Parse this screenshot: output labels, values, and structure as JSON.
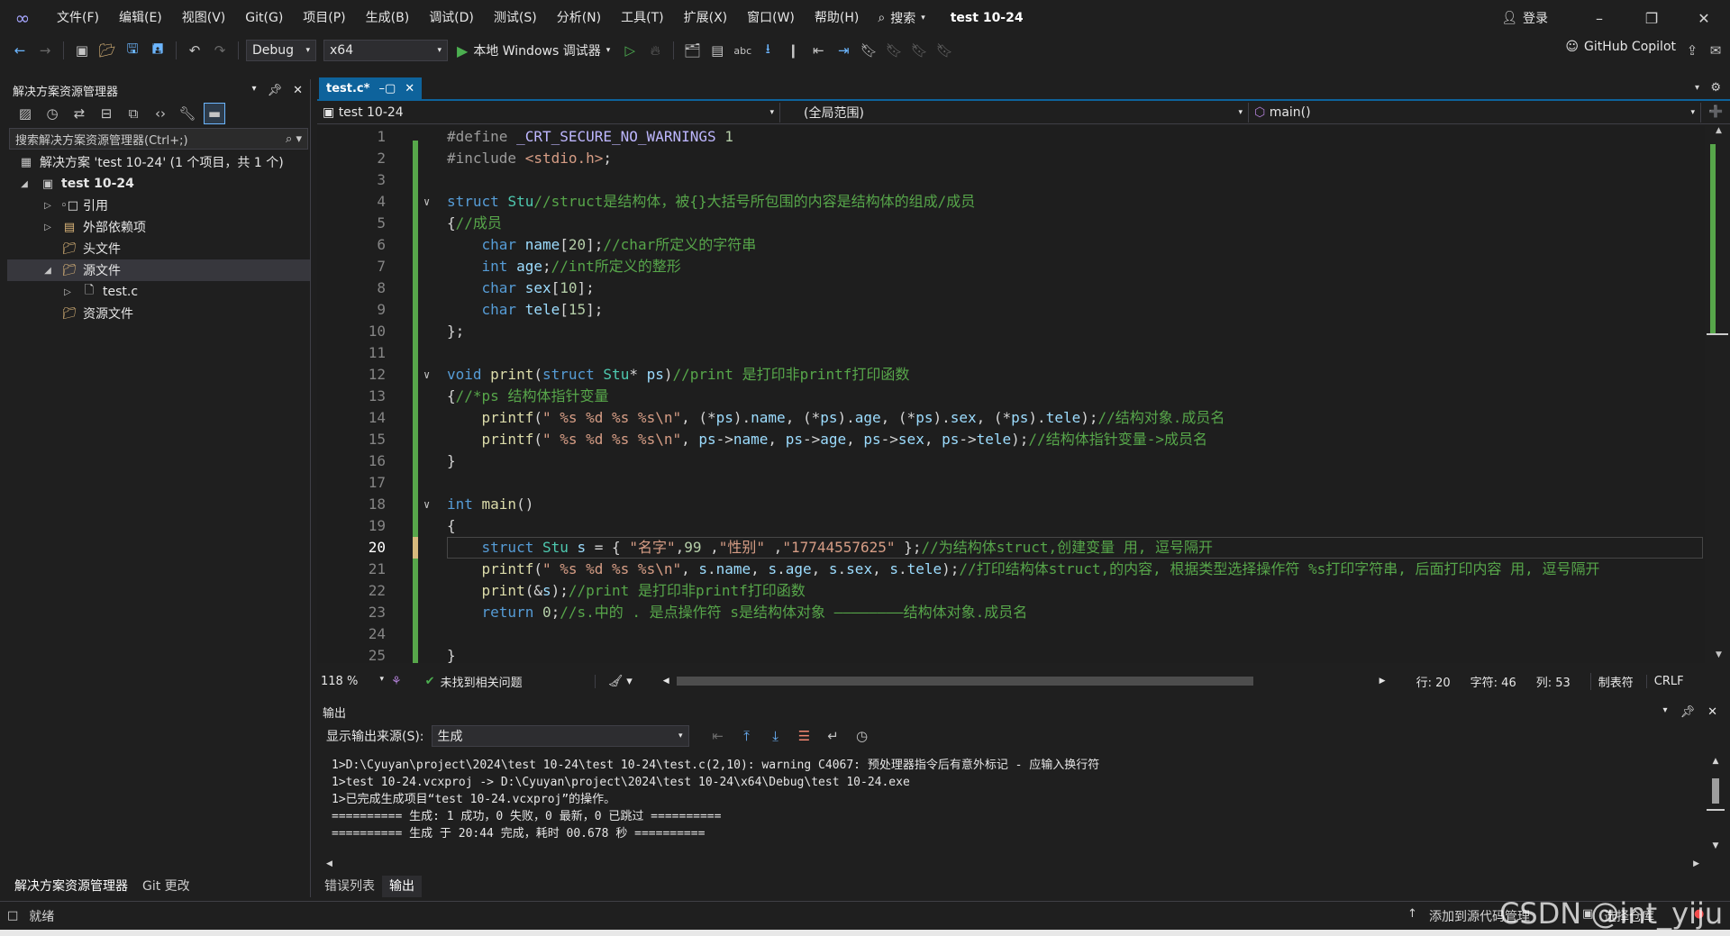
{
  "menu": {
    "items": [
      "文件(F)",
      "编辑(E)",
      "视图(V)",
      "Git(G)",
      "项目(P)",
      "生成(B)",
      "调试(D)",
      "测试(S)",
      "分析(N)",
      "工具(T)",
      "扩展(X)",
      "窗口(W)",
      "帮助(H)"
    ],
    "search_label": "搜索",
    "project_title": "test 10-24",
    "login_label": "登录"
  },
  "toolbar": {
    "config": "Debug",
    "platform": "x64",
    "run_label": "本地 Windows 调试器",
    "copilot_label": "GitHub Copilot"
  },
  "solution_explorer": {
    "title": "解决方案资源管理器",
    "search_placeholder": "搜索解决方案资源管理器(Ctrl+;)",
    "tree": [
      {
        "label": "解决方案 'test 10-24' (1 个项目，共 1 个)",
        "bold": false
      },
      {
        "label": "test 10-24",
        "bold": true
      },
      {
        "label": "引用"
      },
      {
        "label": "外部依赖项"
      },
      {
        "label": "头文件"
      },
      {
        "label": "源文件"
      },
      {
        "label": "test.c"
      },
      {
        "label": "资源文件"
      }
    ],
    "bottom_tabs": [
      "解决方案资源管理器",
      "Git 更改"
    ]
  },
  "editor": {
    "tab_label": "test.c*",
    "nav_project": "test 10-24",
    "nav_scope": "(全局范围)",
    "nav_function": "main()",
    "lines": [
      [
        [
          "pp",
          "#define "
        ],
        [
          "mc",
          "_CRT_SECURE_NO_WARNINGS"
        ],
        [
          "tx",
          " "
        ],
        [
          "nm",
          "1"
        ]
      ],
      [
        [
          "pp",
          "#include "
        ],
        [
          "st",
          "<stdio.h>"
        ],
        [
          "tx",
          ";"
        ]
      ],
      [],
      [
        [
          "kw",
          "struct "
        ],
        [
          "ty",
          "Stu"
        ],
        [
          "cm",
          "//struct是结构体，被{}大括号所包围的内容是结构体的组成/成员"
        ]
      ],
      [
        [
          "tx",
          "{"
        ],
        [
          "cm",
          "//成员"
        ]
      ],
      [
        [
          "tx",
          "    "
        ],
        [
          "kw",
          "char "
        ],
        [
          "vr",
          "name"
        ],
        [
          "tx",
          "["
        ],
        [
          "nm",
          "20"
        ],
        [
          "tx",
          "];"
        ],
        [
          "cm",
          "//char所定义的字符串"
        ]
      ],
      [
        [
          "tx",
          "    "
        ],
        [
          "kw",
          "int "
        ],
        [
          "vr",
          "age"
        ],
        [
          "tx",
          ";"
        ],
        [
          "cm",
          "//int所定义的整形"
        ]
      ],
      [
        [
          "tx",
          "    "
        ],
        [
          "kw",
          "char "
        ],
        [
          "vr",
          "sex"
        ],
        [
          "tx",
          "["
        ],
        [
          "nm",
          "10"
        ],
        [
          "tx",
          "];"
        ]
      ],
      [
        [
          "tx",
          "    "
        ],
        [
          "kw",
          "char "
        ],
        [
          "vr",
          "tele"
        ],
        [
          "tx",
          "["
        ],
        [
          "nm",
          "15"
        ],
        [
          "tx",
          "];"
        ]
      ],
      [
        [
          "tx",
          "};"
        ]
      ],
      [],
      [
        [
          "kw",
          "void "
        ],
        [
          "fn",
          "print"
        ],
        [
          "tx",
          "("
        ],
        [
          "kw",
          "struct "
        ],
        [
          "ty",
          "Stu"
        ],
        [
          "tx",
          "* "
        ],
        [
          "vr",
          "ps"
        ],
        [
          "tx",
          ")"
        ],
        [
          "cm",
          "//print 是打印非printf打印函数"
        ]
      ],
      [
        [
          "tx",
          "{"
        ],
        [
          "cm",
          "//*ps 结构体指针变量"
        ]
      ],
      [
        [
          "tx",
          "    "
        ],
        [
          "fn",
          "printf"
        ],
        [
          "tx",
          "("
        ],
        [
          "st",
          "\" %s %d %s %s\\n\""
        ],
        [
          "tx",
          ", (*"
        ],
        [
          "vr",
          "ps"
        ],
        [
          "tx",
          ")."
        ],
        [
          "vr",
          "name"
        ],
        [
          "tx",
          ", (*"
        ],
        [
          "vr",
          "ps"
        ],
        [
          "tx",
          ")."
        ],
        [
          "vr",
          "age"
        ],
        [
          "tx",
          ", (*"
        ],
        [
          "vr",
          "ps"
        ],
        [
          "tx",
          ")."
        ],
        [
          "vr",
          "sex"
        ],
        [
          "tx",
          ", (*"
        ],
        [
          "vr",
          "ps"
        ],
        [
          "tx",
          ")."
        ],
        [
          "vr",
          "tele"
        ],
        [
          "tx",
          ");"
        ],
        [
          "cm",
          "//结构对象.成员名"
        ]
      ],
      [
        [
          "tx",
          "    "
        ],
        [
          "fn",
          "printf"
        ],
        [
          "tx",
          "("
        ],
        [
          "st",
          "\" %s %d %s %s\\n\""
        ],
        [
          "tx",
          ", "
        ],
        [
          "vr",
          "ps"
        ],
        [
          "tx",
          "->"
        ],
        [
          "vr",
          "name"
        ],
        [
          "tx",
          ", "
        ],
        [
          "vr",
          "ps"
        ],
        [
          "tx",
          "->"
        ],
        [
          "vr",
          "age"
        ],
        [
          "tx",
          ", "
        ],
        [
          "vr",
          "ps"
        ],
        [
          "tx",
          "->"
        ],
        [
          "vr",
          "sex"
        ],
        [
          "tx",
          ", "
        ],
        [
          "vr",
          "ps"
        ],
        [
          "tx",
          "->"
        ],
        [
          "vr",
          "tele"
        ],
        [
          "tx",
          ");"
        ],
        [
          "cm",
          "//结构体指针变量->成员名"
        ]
      ],
      [
        [
          "tx",
          "}"
        ]
      ],
      [],
      [
        [
          "kw",
          "int "
        ],
        [
          "fn",
          "main"
        ],
        [
          "tx",
          "()"
        ]
      ],
      [
        [
          "tx",
          "{"
        ]
      ],
      [
        [
          "tx",
          "    "
        ],
        [
          "kw",
          "struct "
        ],
        [
          "ty",
          "Stu "
        ],
        [
          "vr",
          "s"
        ],
        [
          "tx",
          " = { "
        ],
        [
          "st",
          "\"名字\""
        ],
        [
          "tx",
          ","
        ],
        [
          "nm",
          "99"
        ],
        [
          "tx",
          " ,"
        ],
        [
          "st",
          "\"性别\""
        ],
        [
          "tx",
          " ,"
        ],
        [
          "st",
          "\"17744557625\""
        ],
        [
          "tx",
          " };"
        ],
        [
          "cm",
          "//为结构体struct,创建变量 用, 逗号隔开"
        ]
      ],
      [
        [
          "tx",
          "    "
        ],
        [
          "fn",
          "printf"
        ],
        [
          "tx",
          "("
        ],
        [
          "st",
          "\" %s %d %s %s\\n\""
        ],
        [
          "tx",
          ", "
        ],
        [
          "vr",
          "s"
        ],
        [
          "tx",
          "."
        ],
        [
          "vr",
          "name"
        ],
        [
          "tx",
          ", "
        ],
        [
          "vr",
          "s"
        ],
        [
          "tx",
          "."
        ],
        [
          "vr",
          "age"
        ],
        [
          "tx",
          ", "
        ],
        [
          "vr",
          "s"
        ],
        [
          "tx",
          "."
        ],
        [
          "vr",
          "sex"
        ],
        [
          "tx",
          ", "
        ],
        [
          "vr",
          "s"
        ],
        [
          "tx",
          "."
        ],
        [
          "vr",
          "tele"
        ],
        [
          "tx",
          ");"
        ],
        [
          "cm",
          "//打印结构体struct,的内容, 根据类型选择操作符 %s打印字符串, 后面打印内容 用, 逗号隔开"
        ]
      ],
      [
        [
          "tx",
          "    "
        ],
        [
          "fn",
          "print"
        ],
        [
          "tx",
          "(&"
        ],
        [
          "vr",
          "s"
        ],
        [
          "tx",
          ");"
        ],
        [
          "cm",
          "//print 是打印非printf打印函数"
        ]
      ],
      [
        [
          "tx",
          "    "
        ],
        [
          "kw",
          "return "
        ],
        [
          "nm",
          "0"
        ],
        [
          "tx",
          ";"
        ],
        [
          "cm",
          "//s.中的 . 是点操作符 s是结构体对象 ————————结构体对象.成员名"
        ]
      ],
      [],
      [
        [
          "tx",
          "}"
        ]
      ]
    ],
    "current_line": 20,
    "status": {
      "zoom": "118 %",
      "issues": "未找到相关问题",
      "row": "行: 20",
      "char": "字符: 46",
      "col": "列: 53",
      "tab_mode": "制表符",
      "eol": "CRLF"
    }
  },
  "output": {
    "title": "输出",
    "source_label": "显示输出来源(S):",
    "source_value": "生成",
    "lines": [
      "1>D:\\Cyuyan\\project\\2024\\test 10-24\\test 10-24\\test.c(2,10): warning C4067: 预处理器指令后有意外标记 - 应输入换行符",
      "1>test 10-24.vcxproj -> D:\\Cyuyan\\project\\2024\\test 10-24\\x64\\Debug\\test 10-24.exe",
      "1>已完成生成项目“test 10-24.vcxproj”的操作。",
      "========== 生成: 1 成功，0 失败，0 最新，0 已跳过 ==========",
      "========== 生成 于 20:44 完成，耗时 00.678 秒 =========="
    ],
    "bottom_tabs": [
      "错误列表",
      "输出"
    ]
  },
  "statusbar": {
    "ready": "就绪",
    "add_source": "添加到源代码管理",
    "select_repo": "选择仓库",
    "watermark": "CSDN @int_yiju"
  },
  "colors": {
    "accent": "#0e639c",
    "background": "#1f1f1f",
    "change_bar": "#57a64a"
  }
}
